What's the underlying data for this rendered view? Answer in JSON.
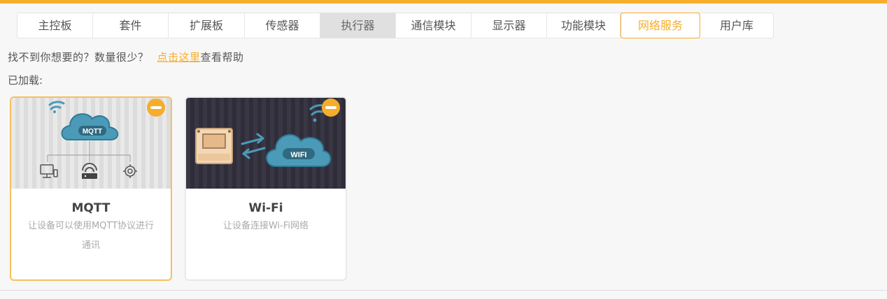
{
  "tabs": [
    {
      "label": "主控板",
      "state": "normal"
    },
    {
      "label": "套件",
      "state": "normal"
    },
    {
      "label": "扩展板",
      "state": "normal"
    },
    {
      "label": "传感器",
      "state": "normal"
    },
    {
      "label": "执行器",
      "state": "disabled"
    },
    {
      "label": "通信模块",
      "state": "normal"
    },
    {
      "label": "显示器",
      "state": "normal"
    },
    {
      "label": "功能模块",
      "state": "normal"
    },
    {
      "label": "网络服务",
      "state": "active"
    },
    {
      "label": "用户库",
      "state": "normal"
    }
  ],
  "help": {
    "prefix": "找不到你想要的？数量很少？",
    "link": "点击这里",
    "suffix": "查看帮助"
  },
  "loaded_label": "已加载:",
  "cards": [
    {
      "name": "MQTT",
      "desc": "让设备可以使用MQTT协议进行通讯",
      "badge": "MQTT",
      "selected": true
    },
    {
      "name": "Wi-Fi",
      "desc": "让设备连接Wi-Fi网络",
      "badge": "WIFI",
      "selected": false
    }
  ],
  "colors": {
    "accent": "#f6ad2c",
    "cloud": "#4b9ab8",
    "cloud_dark": "#2f7a96"
  },
  "icons": [
    "wifi-signal-icon",
    "cloud-icon",
    "computer-icon",
    "router-icon",
    "gear-icon",
    "exchange-arrows-icon",
    "board-icon",
    "remove-icon"
  ]
}
